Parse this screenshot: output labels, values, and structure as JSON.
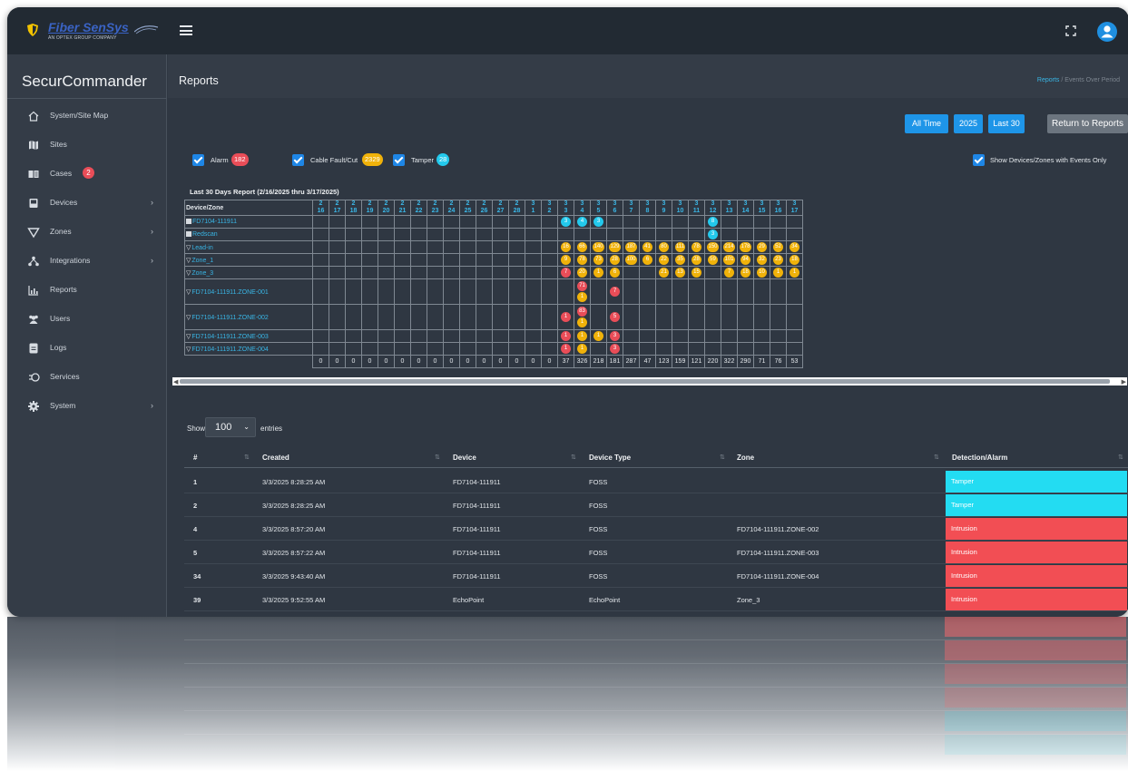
{
  "app": {
    "logo_text": "Fiber SenSys",
    "logo_sub": "AN OPTEX GROUP COMPANY",
    "brand": "SecurCommander",
    "colors": {
      "accent": "#1e95e8",
      "alarm": "#e94d58",
      "cable": "#f0b20a",
      "tamper": "#23c9ec",
      "sidebar": "#343c47"
    }
  },
  "sidebar": {
    "items": [
      {
        "label": "System/Site Map",
        "icon": "home-icon",
        "chevron": false
      },
      {
        "label": "Sites",
        "icon": "map-icon",
        "chevron": false
      },
      {
        "label": "Cases",
        "icon": "cases-icon",
        "chevron": false,
        "badge": "2"
      },
      {
        "label": "Devices",
        "icon": "device-icon",
        "chevron": true
      },
      {
        "label": "Zones",
        "icon": "zones-icon",
        "chevron": true
      },
      {
        "label": "Integrations",
        "icon": "integrations-icon",
        "chevron": true
      },
      {
        "label": "Reports",
        "icon": "reports-icon",
        "chevron": false
      },
      {
        "label": "Users",
        "icon": "users-icon",
        "chevron": false
      },
      {
        "label": "Logs",
        "icon": "logs-icon",
        "chevron": false
      },
      {
        "label": "Services",
        "icon": "services-icon",
        "chevron": false
      },
      {
        "label": "System",
        "icon": "gear-icon",
        "chevron": true
      }
    ]
  },
  "header": {
    "title": "Reports",
    "breadcrumb_link": "Reports",
    "breadcrumb_sep": "/",
    "breadcrumb_current": "Events Over Period"
  },
  "toolbar": {
    "all_time": "All Time",
    "year": "2025",
    "last30": "Last 30",
    "return": "Return to Reports"
  },
  "filters": {
    "alarm_label": "Alarm",
    "alarm_count": "182",
    "cable_label": "Cable Fault/Cut",
    "cable_count": "2329",
    "tamper_label": "Tamper",
    "tamper_count": "28",
    "events_only_label": "Show Devices/Zones with Events Only"
  },
  "report": {
    "title": "Last 30 Days Report (2/16/2025 thru 3/17/2025)",
    "device_zone_header": "Device/Zone",
    "dates": [
      [
        "2",
        "16"
      ],
      [
        "2",
        "17"
      ],
      [
        "2",
        "18"
      ],
      [
        "2",
        "19"
      ],
      [
        "2",
        "20"
      ],
      [
        "2",
        "21"
      ],
      [
        "2",
        "22"
      ],
      [
        "2",
        "23"
      ],
      [
        "2",
        "24"
      ],
      [
        "2",
        "25"
      ],
      [
        "2",
        "26"
      ],
      [
        "2",
        "27"
      ],
      [
        "2",
        "28"
      ],
      [
        "3",
        "1"
      ],
      [
        "3",
        "2"
      ],
      [
        "3",
        "3"
      ],
      [
        "3",
        "4"
      ],
      [
        "3",
        "5"
      ],
      [
        "3",
        "6"
      ],
      [
        "3",
        "7"
      ],
      [
        "3",
        "8"
      ],
      [
        "3",
        "9"
      ],
      [
        "3",
        "10"
      ],
      [
        "3",
        "11"
      ],
      [
        "3",
        "12"
      ],
      [
        "3",
        "13"
      ],
      [
        "3",
        "14"
      ],
      [
        "3",
        "15"
      ],
      [
        "3",
        "16"
      ],
      [
        "3",
        "17"
      ]
    ],
    "rows": [
      {
        "name": "FD7104-111911",
        "marker": "square",
        "tall": false,
        "cells": {
          "15": [
            [
              "t",
              "3"
            ]
          ],
          "16": [
            [
              "t",
              "4"
            ]
          ],
          "17": [
            [
              "t",
              "3"
            ]
          ],
          "24": [
            [
              "t",
              "8"
            ]
          ]
        }
      },
      {
        "name": "Redscan",
        "marker": "square",
        "tall": false,
        "cells": {
          "24": [
            [
              "t",
              "3"
            ]
          ]
        }
      },
      {
        "name": "Lead-in",
        "marker": "triangle",
        "tall": false,
        "cells": {
          "15": [
            [
              "c",
              "16"
            ]
          ],
          "16": [
            [
              "c",
              "66"
            ]
          ],
          "17": [
            [
              "c",
              "140"
            ]
          ],
          "18": [
            [
              "c",
              "129"
            ]
          ],
          "19": [
            [
              "c",
              "187"
            ]
          ],
          "20": [
            [
              "c",
              "41"
            ]
          ],
          "21": [
            [
              "c",
              "80"
            ]
          ],
          "22": [
            [
              "c",
              "111"
            ]
          ],
          "23": [
            [
              "c",
              "78"
            ]
          ],
          "24": [
            [
              "c",
              "150"
            ]
          ],
          "25": [
            [
              "c",
              "214"
            ]
          ],
          "26": [
            [
              "c",
              "178"
            ]
          ],
          "27": [
            [
              "c",
              "29"
            ]
          ],
          "28": [
            [
              "c",
              "52"
            ]
          ],
          "29": [
            [
              "c",
              "34"
            ]
          ]
        }
      },
      {
        "name": "Zone_1",
        "marker": "triangle",
        "tall": false,
        "cells": {
          "15": [
            [
              "c",
              "9"
            ]
          ],
          "16": [
            [
              "c",
              "78"
            ]
          ],
          "17": [
            [
              "c",
              "73"
            ]
          ],
          "18": [
            [
              "c",
              "28"
            ]
          ],
          "19": [
            [
              "c",
              "100"
            ]
          ],
          "20": [
            [
              "c",
              "6"
            ]
          ],
          "21": [
            [
              "c",
              "22"
            ]
          ],
          "22": [
            [
              "c",
              "35"
            ]
          ],
          "23": [
            [
              "c",
              "28"
            ]
          ],
          "24": [
            [
              "c",
              "59"
            ]
          ],
          "25": [
            [
              "c",
              "101"
            ]
          ],
          "26": [
            [
              "c",
              "94"
            ]
          ],
          "27": [
            [
              "c",
              "32"
            ]
          ],
          "28": [
            [
              "c",
              "23"
            ]
          ],
          "29": [
            [
              "c",
              "18"
            ]
          ]
        }
      },
      {
        "name": "Zone_3",
        "marker": "triangle",
        "tall": false,
        "cells": {
          "15": [
            [
              "a",
              "7"
            ]
          ],
          "16": [
            [
              "c",
              "20"
            ]
          ],
          "17": [
            [
              "c",
              "1"
            ]
          ],
          "18": [
            [
              "c",
              "6"
            ]
          ],
          "21": [
            [
              "c",
              "21"
            ]
          ],
          "22": [
            [
              "c",
              "13"
            ]
          ],
          "23": [
            [
              "c",
              "15"
            ]
          ],
          "25": [
            [
              "c",
              "7"
            ]
          ],
          "26": [
            [
              "c",
              "18"
            ]
          ],
          "27": [
            [
              "c",
              "10"
            ]
          ],
          "28": [
            [
              "c",
              "1"
            ]
          ],
          "29": [
            [
              "c",
              "1"
            ]
          ]
        }
      },
      {
        "name": "FD7104-111911.ZONE-001",
        "marker": "triangle",
        "tall": true,
        "cells": {
          "16": [
            [
              "a",
              "71"
            ],
            [
              "c",
              "1"
            ]
          ],
          "18": [
            [
              "a",
              "7"
            ]
          ]
        }
      },
      {
        "name": "FD7104-111911.ZONE-002",
        "marker": "triangle",
        "tall": true,
        "cells": {
          "15": [
            [
              "a",
              "1"
            ]
          ],
          "16": [
            [
              "a",
              "83"
            ],
            [
              "c",
              "1"
            ]
          ],
          "18": [
            [
              "a",
              "5"
            ]
          ]
        }
      },
      {
        "name": "FD7104-111911.ZONE-003",
        "marker": "triangle",
        "tall": false,
        "cells": {
          "15": [
            [
              "a",
              "1"
            ]
          ],
          "16": [
            [
              "c",
              "1"
            ]
          ],
          "17": [
            [
              "c",
              "1"
            ]
          ],
          "18": [
            [
              "a",
              "3"
            ]
          ]
        }
      },
      {
        "name": "FD7104-111911.ZONE-004",
        "marker": "triangle",
        "tall": false,
        "cells": {
          "15": [
            [
              "a",
              "1"
            ]
          ],
          "16": [
            [
              "c",
              "1"
            ]
          ],
          "18": [
            [
              "a",
              "3"
            ]
          ]
        }
      }
    ],
    "totals": [
      "0",
      "0",
      "0",
      "0",
      "0",
      "0",
      "0",
      "0",
      "0",
      "0",
      "0",
      "0",
      "0",
      "0",
      "0",
      "37",
      "326",
      "218",
      "181",
      "287",
      "47",
      "123",
      "159",
      "121",
      "220",
      "322",
      "290",
      "71",
      "76",
      "53"
    ]
  },
  "entries": {
    "show_label": "Show",
    "value": "100",
    "entries_label": "entries"
  },
  "table": {
    "headers": {
      "num": "#",
      "created": "Created",
      "device": "Device",
      "device_type": "Device Type",
      "zone": "Zone",
      "detection": "Detection/Alarm"
    },
    "rows": [
      {
        "num": "1",
        "created": "3/3/2025 8:28:25 AM",
        "device": "FD7104-111911",
        "type": "FOSS",
        "zone": "",
        "alarm": "Tamper",
        "kind": "tamper"
      },
      {
        "num": "2",
        "created": "3/3/2025 8:28:25 AM",
        "device": "FD7104-111911",
        "type": "FOSS",
        "zone": "",
        "alarm": "Tamper",
        "kind": "tamper"
      },
      {
        "num": "4",
        "created": "3/3/2025 8:57:20 AM",
        "device": "FD7104-111911",
        "type": "FOSS",
        "zone": "FD7104-111911.ZONE-002",
        "alarm": "Intrusion",
        "kind": "intrusion"
      },
      {
        "num": "5",
        "created": "3/3/2025 8:57:22 AM",
        "device": "FD7104-111911",
        "type": "FOSS",
        "zone": "FD7104-111911.ZONE-003",
        "alarm": "Intrusion",
        "kind": "intrusion"
      },
      {
        "num": "34",
        "created": "3/3/2025 9:43:40 AM",
        "device": "FD7104-111911",
        "type": "FOSS",
        "zone": "FD7104-111911.ZONE-004",
        "alarm": "Intrusion",
        "kind": "intrusion"
      },
      {
        "num": "39",
        "created": "3/3/2025 9:52:55 AM",
        "device": "EchoPoint",
        "type": "EchoPoint",
        "zone": "Zone_3",
        "alarm": "Intrusion",
        "kind": "intrusion"
      }
    ]
  }
}
